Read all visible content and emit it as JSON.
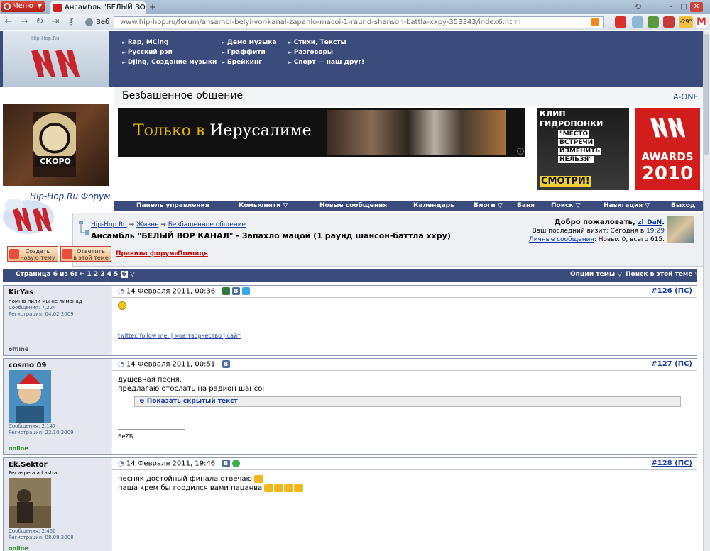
{
  "browser": {
    "menu_label": "Меню",
    "tab_title": "Ансамбль \"БЕЛЫЙ ВО...",
    "tab_close": "×",
    "new_tab": "+",
    "search_engine": "Веб",
    "url": "www.hip-hop.ru/forum/ansambl-belyi-vor-kanal-zapahlo-macoi-1-raund-shanson-battla-xxpy-353343/index6.html",
    "weather_badge": "-29°",
    "window_controls": [
      "–",
      "□",
      "✕"
    ]
  },
  "site": {
    "logo_url": "Hip-Hop.Ru",
    "forum_label": "Hip-Hop.Ru Форум",
    "top_nav": [
      {
        "label": "Rap, MCing"
      },
      {
        "label": "Русский рэп"
      },
      {
        "label": "DJing, Создание музыки"
      },
      {
        "label": "Демо музыка"
      },
      {
        "label": "Граффити"
      },
      {
        "label": "Брейкинг"
      },
      {
        "label": "Стихи, Тексты"
      },
      {
        "label": "Разговоры"
      },
      {
        "label": "Спорт — наш друг!"
      }
    ],
    "section_title": "Безбашенное общение",
    "section_right": "A-ONE",
    "ad_text_1": "Только в ",
    "ad_text_2": "Иерусалиме",
    "side_ad_label": "СКОРО",
    "clip_ad": [
      "КЛИП",
      "ГИДРОПОНКИ",
      "\"МЕСТО",
      "ВСТРЕЧИ",
      "ИЗМЕНИТЬ",
      "НЕЛЬЗЯ\"",
      "СМОТРИ!"
    ],
    "awards_ad": [
      "AWARDS",
      "2010"
    ]
  },
  "forum_menu": [
    {
      "label": "Панель управления"
    },
    {
      "label": "Комьюнити ▽"
    },
    {
      "label": "Новые сообщения"
    },
    {
      "label": "Календарь"
    },
    {
      "label": "Блоги ▽"
    },
    {
      "label": "Баня"
    },
    {
      "label": "Поиск ▽"
    },
    {
      "label": "Навигация ▽"
    },
    {
      "label": "Выход"
    }
  ],
  "breadcrumb": {
    "root": "Hip-Hop.Ru",
    "sep": " → ",
    "level1": "Жизнь",
    "level2": "Безбашенное общение"
  },
  "thread": {
    "title": "Ансамбль \"БЕЛЫЙ ВОР КАНАЛ\"",
    "subtitle": " - Запахло мацой (1 раунд шансон-баттла ххру)"
  },
  "welcome": {
    "greeting": "Добро пожаловать, ",
    "user": "zl_DaN",
    "last_visit_label": "Ваш последний визит: Сегодня в ",
    "last_visit_time": "19:29",
    "pm_link": "Личные сообщения",
    "pm_text": ": Новых 0, всего 615."
  },
  "buttons": {
    "new_topic": "Создать\nновую тему",
    "reply": "Ответить\nв этой теме",
    "rules": "Правила форума",
    "help": "Помощь"
  },
  "pagination": {
    "label": "Страница 6 из 6:",
    "prev": "←",
    "pages": [
      "1",
      "2",
      "3",
      "4",
      "5"
    ],
    "current": "6",
    "thread_options": "Опции темы ▽",
    "search_thread": "Поиск в этой теме ▽"
  },
  "posts": [
    {
      "author": "KirYas",
      "user_title": "помню пили мы не лимонад",
      "messages": "Сообщения: 7,224",
      "registered": "Регистрация: 04.02.2009",
      "status": "offline",
      "date": "14 Февраля 2011, 00:36",
      "number": "#126",
      "ps": "(ПС)",
      "text_lines": [],
      "signature": "twitter. follow me. | мое творчество | сайт"
    },
    {
      "author": "cosmo 09",
      "user_title": "",
      "messages": "Сообщения: 2,147",
      "registered": "Регистрация: 22.10.2009",
      "status": "online",
      "date": "14 Февраля 2011, 00:51",
      "number": "#127",
      "ps": "(ПС)",
      "text_lines": [
        "душевная песня.",
        "предлагаю отослать на радион шансон"
      ],
      "spoiler": "Показать скрытый текст",
      "signature": "БеZБ"
    },
    {
      "author": "Ek.Sektor",
      "user_title": "Per aspera ad astra",
      "messages": "Сообщения: 2,450",
      "registered": "Регистрация: 08.08.2008",
      "status": "online",
      "date": "14 Февраля 2011, 19:46",
      "number": "#128",
      "ps": "(ПС)",
      "text_lines": [
        "песняк достойный финала отвечаю",
        "паша крем бы гордился вами пацанва"
      ]
    }
  ],
  "colors": {
    "accent": "#3a4b7c",
    "link": "#1b3e9a",
    "online": "#2e8b1e",
    "offline": "#556"
  }
}
